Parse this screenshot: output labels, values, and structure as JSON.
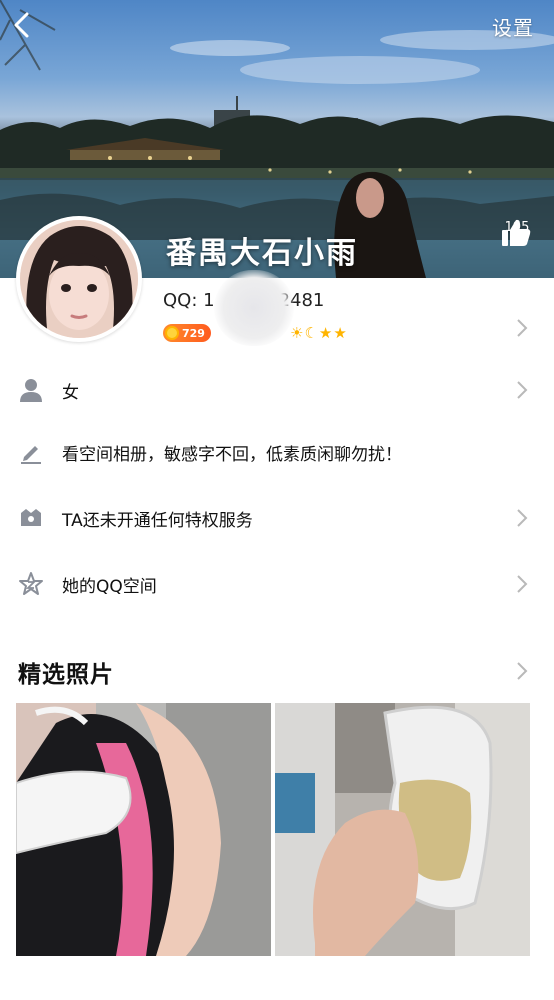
{
  "header": {
    "settings_label": "设置"
  },
  "profile": {
    "nickname": "番禺大石小雨",
    "like_count": "195",
    "qq_prefix": "QQ: 1",
    "qq_suffix": "2481",
    "level_value": "729"
  },
  "info_rows": [
    {
      "label": "女"
    },
    {
      "label": "看空间相册，敏感字不回，低素质闲聊勿扰！"
    },
    {
      "label": "TA还未开通任何特权服务"
    },
    {
      "label": "她的QQ空间"
    }
  ],
  "photos_section": {
    "title": "精选照片"
  },
  "colors": {
    "accent_orange": "#ff6a22",
    "chevron_gray": "#b9b9b9",
    "icon_gray": "#8a8f99"
  },
  "icons": [
    "back-icon",
    "settings-text",
    "thumbs-up-icon",
    "person-icon",
    "pencil-icon",
    "privilege-icon",
    "star-space-icon",
    "chevron-right-icon"
  ]
}
